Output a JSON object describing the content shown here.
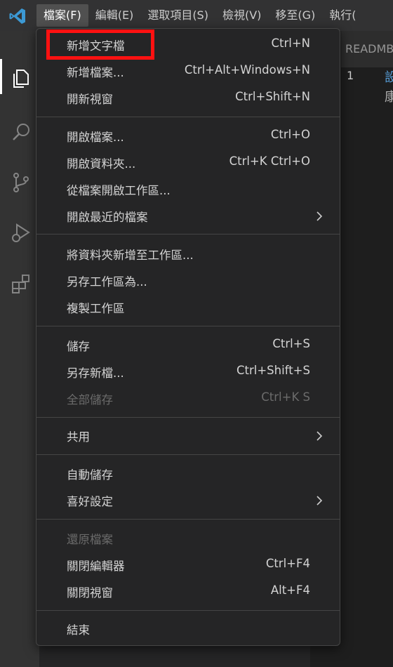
{
  "menubar": {
    "items": [
      {
        "label": "檔案(F)",
        "active": true
      },
      {
        "label": "編輯(E)",
        "active": false
      },
      {
        "label": "選取項目(S)",
        "active": false
      },
      {
        "label": "檢視(V)",
        "active": false
      },
      {
        "label": "移至(G)",
        "active": false
      },
      {
        "label": "執行("
      }
    ]
  },
  "editor": {
    "tab_label": "READMB",
    "line_number": "1",
    "code_fragment_1": "設",
    "code_fragment_2": "康"
  },
  "file_menu": {
    "items": [
      {
        "label": "新增文字檔",
        "shortcut": "Ctrl+N"
      },
      {
        "label": "新增檔案...",
        "shortcut": "Ctrl+Alt+Windows+N"
      },
      {
        "label": "開新視窗",
        "shortcut": "Ctrl+Shift+N"
      },
      {
        "label": "開啟檔案...",
        "shortcut": "Ctrl+O"
      },
      {
        "label": "開啟資料夾...",
        "shortcut": "Ctrl+K Ctrl+O"
      },
      {
        "label": "從檔案開啟工作區..."
      },
      {
        "label": "開啟最近的檔案",
        "submenu_icon": "chevron-right-icon"
      },
      {
        "label": "將資料夾新增至工作區..."
      },
      {
        "label": "另存工作區為..."
      },
      {
        "label": "複製工作區"
      },
      {
        "label": "儲存",
        "shortcut": "Ctrl+S"
      },
      {
        "label": "另存新檔...",
        "shortcut": "Ctrl+Shift+S"
      },
      {
        "label": "全部儲存",
        "shortcut": "Ctrl+K S",
        "disabled": true
      },
      {
        "label": "共用",
        "submenu_icon": "chevron-right-icon"
      },
      {
        "label": "自動儲存"
      },
      {
        "label": "喜好設定",
        "submenu_icon": "chevron-right-icon"
      },
      {
        "label": "還原檔案",
        "disabled": true
      },
      {
        "label": "關閉編輯器",
        "shortcut": "Ctrl+F4"
      },
      {
        "label": "關閉視窗",
        "shortcut": "Alt+F4"
      },
      {
        "label": "結束"
      }
    ]
  },
  "activity_bar": {
    "icons": [
      "explorer-icon",
      "search-icon",
      "source-control-icon",
      "run-debug-icon",
      "extensions-icon"
    ]
  },
  "colors": {
    "highlight_border": "#ff1111",
    "menu_background": "#252526",
    "vscode_blue": "#3c99d4"
  }
}
